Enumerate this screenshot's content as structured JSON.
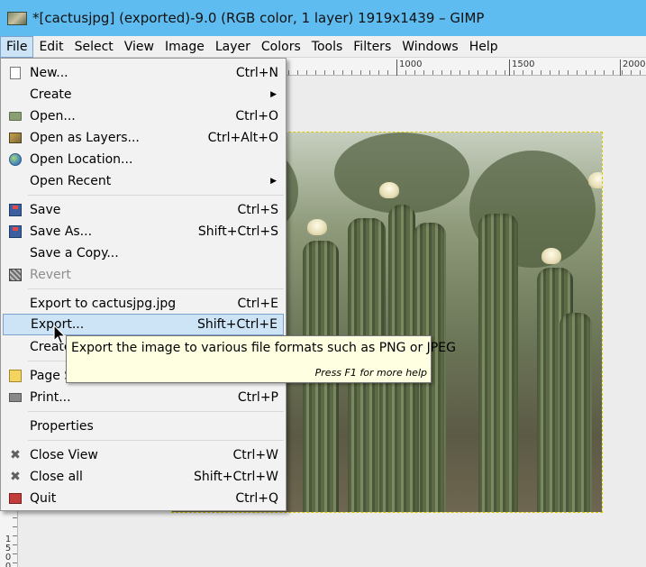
{
  "window": {
    "title": "*[cactusjpg] (exported)-9.0 (RGB color, 1 layer) 1919x1439 – GIMP"
  },
  "menubar": {
    "items": [
      {
        "label": "File",
        "active": true
      },
      {
        "label": "Edit"
      },
      {
        "label": "Select"
      },
      {
        "label": "View"
      },
      {
        "label": "Image"
      },
      {
        "label": "Layer"
      },
      {
        "label": "Colors"
      },
      {
        "label": "Tools"
      },
      {
        "label": "Filters"
      },
      {
        "label": "Windows"
      },
      {
        "label": "Help"
      }
    ]
  },
  "rulers": {
    "top_labels": [
      "1000",
      "1500",
      "2000"
    ],
    "left_labels": [
      "1",
      "5",
      "0",
      "0"
    ]
  },
  "file_menu": {
    "items": [
      {
        "label": "New...",
        "shortcut": "Ctrl+N",
        "icon": "new-document-icon"
      },
      {
        "label": "Create",
        "submenu": true
      },
      {
        "label": "Open...",
        "shortcut": "Ctrl+O",
        "icon": "open-folder-icon"
      },
      {
        "label": "Open as Layers...",
        "shortcut": "Ctrl+Alt+O",
        "icon": "layers-icon"
      },
      {
        "label": "Open Location...",
        "icon": "globe-icon"
      },
      {
        "label": "Open Recent",
        "submenu": true
      },
      {
        "label": "Save",
        "shortcut": "Ctrl+S",
        "icon": "save-icon"
      },
      {
        "label": "Save As...",
        "shortcut": "Shift+Ctrl+S",
        "icon": "save-as-icon"
      },
      {
        "label": "Save a Copy..."
      },
      {
        "label": "Revert",
        "disabled": true,
        "icon": "revert-icon"
      },
      {
        "label": "Export to cactusjpg.jpg",
        "shortcut": "Ctrl+E"
      },
      {
        "label": "Export...",
        "shortcut": "Shift+Ctrl+E",
        "highlighted": true
      },
      {
        "label": "Create"
      },
      {
        "label": "Page S",
        "icon": "page-setup-icon"
      },
      {
        "label": "Print...",
        "shortcut": "Ctrl+P",
        "icon": "print-icon"
      },
      {
        "label": "Properties"
      },
      {
        "label": "Close View",
        "shortcut": "Ctrl+W",
        "icon": "close-icon"
      },
      {
        "label": "Close all",
        "shortcut": "Shift+Ctrl+W",
        "icon": "close-all-icon"
      },
      {
        "label": "Quit",
        "shortcut": "Ctrl+Q",
        "icon": "quit-icon"
      }
    ]
  },
  "tooltip": {
    "text": "Export the image to various file formats such as PNG or JPEG",
    "hint": "Press F1 for more help"
  },
  "colors": {
    "titlebar": "#5ebcf0",
    "menu_highlight": "#cde4f7",
    "tooltip_bg": "#ffffe1"
  }
}
